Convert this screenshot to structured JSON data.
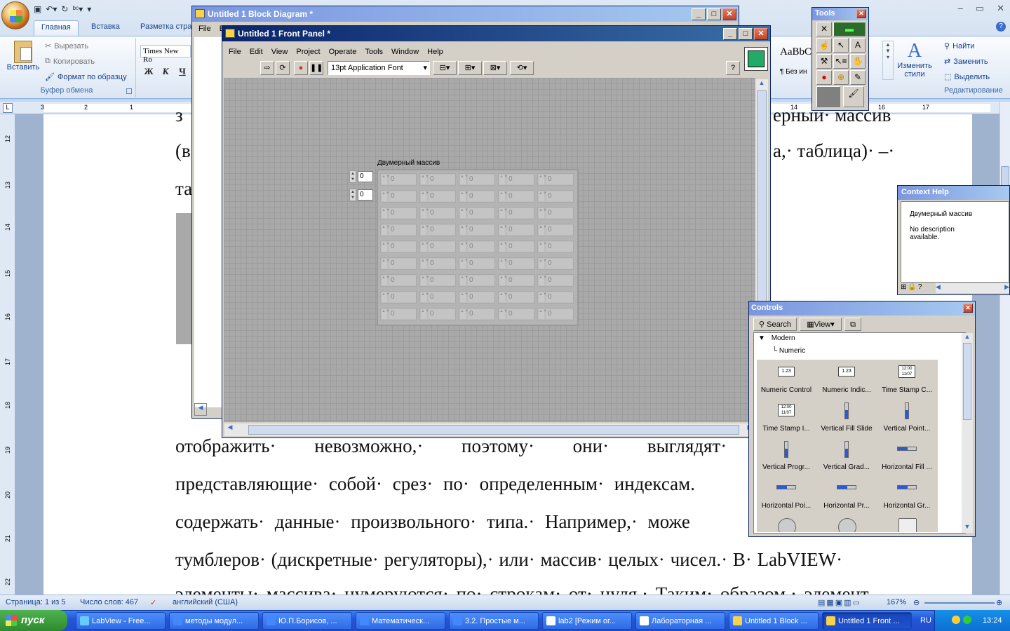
{
  "word": {
    "tabs": [
      "Главная",
      "Вставка",
      "Разметка стра"
    ],
    "clipboard": {
      "paste": "Вставить",
      "cut": "Вырезать",
      "copy": "Копировать",
      "format_painter": "Формат по образцу",
      "group": "Буфер обмена"
    },
    "font_name": "Times New Ro",
    "format_buttons": [
      "Ж",
      "К",
      "Ч"
    ],
    "styles": {
      "sample": "AaBbC",
      "no_spacing": "¶ Без ин",
      "change_styles": "Изменить стили"
    },
    "editing": {
      "find": "Найти",
      "replace": "Заменить",
      "select": "Выделить",
      "group": "Редактирование"
    },
    "ruler_numbers": [
      "3",
      "2",
      "1",
      "1",
      "14",
      "16",
      "17"
    ],
    "left_ruler_numbers": [
      "12",
      "13",
      "14",
      "15",
      "16",
      "17",
      "18",
      "19",
      "20",
      "21",
      "22"
    ],
    "doc_lines_top": [
      {
        "left": "з",
        "right": "ерный· массив"
      },
      {
        "left": "(в",
        "right": "а,· таблица)· –·"
      },
      {
        "left": "та",
        "right": ""
      }
    ],
    "doc_lines": [
      "отображить· невозможно,· поэтому· они· выглядят·",
      "представляющие· собой· срез· по· определенным· индексам.",
      "содержать· данные· произвольного· типа.· Например,· може",
      "тумблеров· (дискретные· регуляторы),· или· массив· целых· чисел.· В· LabVIEW·",
      "элементы· массива· нумеруются· по· строкам· от· нуля.· Таким· образом,· элемент"
    ],
    "status": {
      "page": "Страница: 1 из 5",
      "words": "Число слов: 467",
      "lang": "английский (США)",
      "zoom": "167%"
    }
  },
  "block_diagram": {
    "title": "Untitled 1 Block Diagram *",
    "menu": [
      "File",
      "E"
    ]
  },
  "front_panel": {
    "title": "Untitled 1 Front Panel *",
    "menu": [
      "File",
      "Edit",
      "View",
      "Project",
      "Operate",
      "Tools",
      "Window",
      "Help"
    ],
    "font": "13pt Application Font",
    "array_label": "Двумерный массив",
    "index_values": [
      "0",
      "0"
    ],
    "cell_value": "0",
    "rows": 9,
    "cols": 5
  },
  "tools_palette": {
    "title": "Tools"
  },
  "context_help": {
    "title": "Context Help",
    "name": "Двумерный массив",
    "desc": "No description available."
  },
  "controls_palette": {
    "title": "Controls",
    "search": "Search",
    "view": "View",
    "tree": [
      "Modern",
      "Numeric"
    ],
    "items": [
      {
        "label": "Numeric Control",
        "icon": "numeric-control-icon"
      },
      {
        "label": "Numeric Indic...",
        "icon": "numeric-indicator-icon"
      },
      {
        "label": "Time Stamp C...",
        "icon": "time-stamp-control-icon"
      },
      {
        "label": "Time Stamp I...",
        "icon": "time-stamp-indicator-icon"
      },
      {
        "label": "Vertical Fill Slide",
        "icon": "vertical-fill-slide-icon"
      },
      {
        "label": "Vertical Point...",
        "icon": "vertical-pointer-slide-icon"
      },
      {
        "label": "Vertical Progr...",
        "icon": "vertical-progress-bar-icon"
      },
      {
        "label": "Vertical Grad...",
        "icon": "vertical-graduated-bar-icon"
      },
      {
        "label": "Horizontal Fill ...",
        "icon": "horizontal-fill-slide-icon"
      },
      {
        "label": "Horizontal Poi...",
        "icon": "horizontal-pointer-slide-icon"
      },
      {
        "label": "Horizontal Pr...",
        "icon": "horizontal-progress-bar-icon"
      },
      {
        "label": "Horizontal Gr...",
        "icon": "horizontal-graduated-bar-icon"
      }
    ]
  },
  "taskbar": {
    "start": "пуск",
    "tasks": [
      "LabView - Free...",
      "методы модул...",
      "Ю.П.Борисов, ...",
      "Математическ...",
      "3.2. Простые м...",
      "lab2 [Режим ог...",
      "Лабораторная ...",
      "Untitled 1 Block ...",
      "Untitled 1 Front ..."
    ],
    "lang": "RU",
    "time": "13:24"
  }
}
